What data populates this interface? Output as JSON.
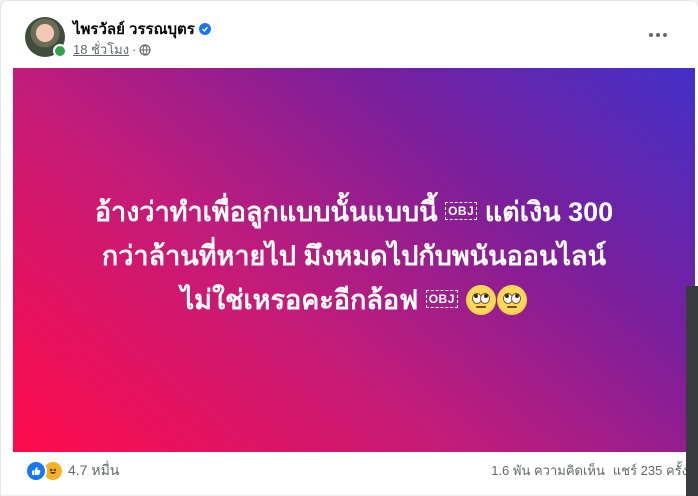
{
  "post": {
    "author_name": "ไพรวัลย์ วรรณบุตร",
    "timestamp": "18 ชั่วโมง",
    "separator": "·",
    "verified": true,
    "privacy_icon": "globe-icon",
    "background_gradient": [
      "#ff0a4a",
      "#c21c7a",
      "#7a1f9c",
      "#4330c8"
    ],
    "text_lines": [
      "อ้างว่าทำเพื่อลูกแบบนั้นแบบนี้",
      "แต่เงิน 300",
      "กว่าล้านที่หายไป มึงหมดไปกับพนันออนไลน์",
      "ไม่ใช่เหรอคะอีกล้อฟ"
    ],
    "obj_placeholder": "OBJ"
  },
  "footer": {
    "reaction_icons": [
      "like-icon",
      "haha-icon"
    ],
    "reaction_count": "4.7 หมื่น",
    "comments": "1.6 พัน ความคิดเห็น",
    "shares": "แชร์ 235 ครั้ง"
  },
  "colors": {
    "accent": "#1877f2",
    "online": "#31a24c"
  }
}
